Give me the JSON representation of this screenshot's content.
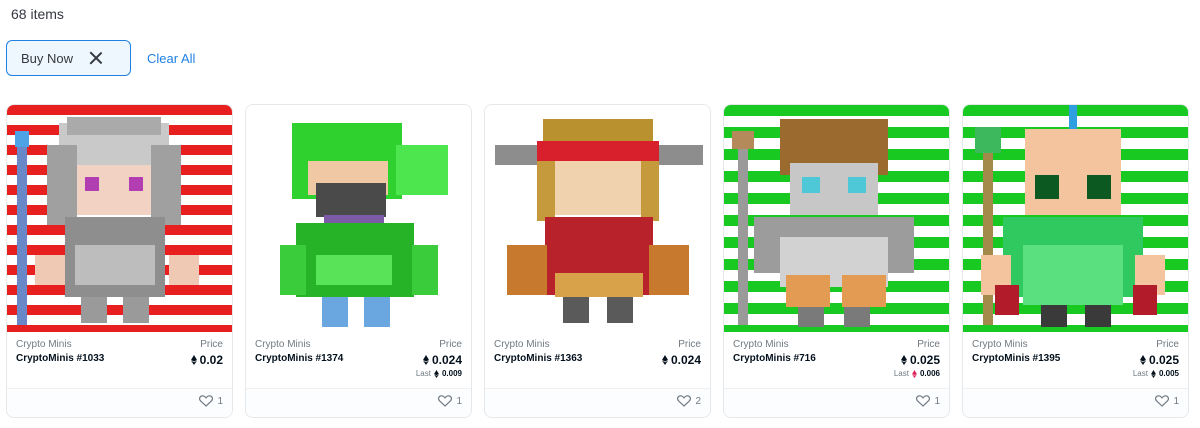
{
  "results": {
    "count_text": "68 items"
  },
  "filters": {
    "active_chip": "Buy Now",
    "clear_all": "Clear All"
  },
  "colors": {
    "accent": "#2081e2",
    "stripe_red": "#e81f1f",
    "stripe_green": "#17c920"
  },
  "cards": [
    {
      "collection": "Crypto Minis",
      "name": "CryptoMinis #1033",
      "price_label": "Price",
      "price": "0.02",
      "last_label": "",
      "last": "",
      "favorites": "1",
      "background": "red"
    },
    {
      "collection": "Crypto Minis",
      "name": "CryptoMinis #1374",
      "price_label": "Price",
      "price": "0.024",
      "last_label": "Last",
      "last": "0.009",
      "favorites": "1",
      "background": "plain"
    },
    {
      "collection": "Crypto Minis",
      "name": "CryptoMinis #1363",
      "price_label": "Price",
      "price": "0.024",
      "last_label": "",
      "last": "",
      "favorites": "2",
      "background": "plain"
    },
    {
      "collection": "Crypto Minis",
      "name": "CryptoMinis #716",
      "price_label": "Price",
      "price": "0.025",
      "last_label": "Last",
      "last": "0.006",
      "favorites": "1",
      "background": "green"
    },
    {
      "collection": "Crypto Minis",
      "name": "CryptoMinis #1395",
      "price_label": "Price",
      "price": "0.025",
      "last_label": "Last",
      "last": "0.005",
      "favorites": "1",
      "background": "green"
    }
  ],
  "icons": {
    "currency": "ethereum-icon",
    "favorite": "heart-icon",
    "remove": "close-icon"
  }
}
